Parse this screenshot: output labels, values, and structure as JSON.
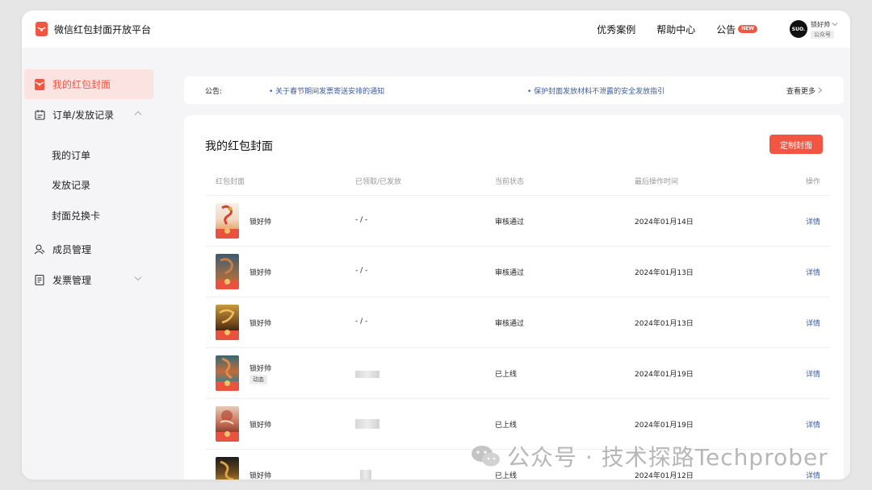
{
  "header": {
    "brand": "微信红包封面开放平台",
    "nav": [
      "优秀案例",
      "帮助中心"
    ],
    "notice_label": "公告",
    "new_badge": "NEW",
    "user": {
      "avatar_text": "SUO.",
      "name": "锁好帅",
      "tag": "公众号"
    }
  },
  "sidebar": {
    "items": [
      {
        "label": "我的红包封面",
        "icon": "red-envelope-icon",
        "active": true
      },
      {
        "label": "订单/发放记录",
        "icon": "calendar-icon",
        "expanded": true
      },
      {
        "label": "成员管理",
        "icon": "member-icon"
      },
      {
        "label": "发票管理",
        "icon": "invoice-icon",
        "expanded": false
      }
    ],
    "sub_items": [
      "我的订单",
      "发放记录",
      "封面兑换卡"
    ]
  },
  "notice_bar": {
    "label": "公告:",
    "items": [
      "关于春节期间发票寄送安排的通知",
      "保护封面发放材料不泄露的安全发放指引"
    ],
    "more": "查看更多"
  },
  "main": {
    "title": "我的红包封面",
    "create_button": "定制封面",
    "columns": [
      "红包封面",
      "已领取/已发放",
      "当前状态",
      "最后操作时间",
      "操作"
    ],
    "rows": [
      {
        "name": "锁好帅",
        "tag": "",
        "count": "- / -",
        "status": "审核通过",
        "time": "2024年01月14日",
        "action": "详情"
      },
      {
        "name": "锁好帅",
        "tag": "",
        "count": "- / -",
        "status": "审核通过",
        "time": "2024年01月13日",
        "action": "详情"
      },
      {
        "name": "锁好帅",
        "tag": "",
        "count": "- / -",
        "status": "审核通过",
        "time": "2024年01月13日",
        "action": "详情"
      },
      {
        "name": "锁好帅",
        "tag": "动态",
        "count": "",
        "status": "已上线",
        "time": "2024年01月19日",
        "action": "详情"
      },
      {
        "name": "锁好帅",
        "tag": "",
        "count": "",
        "status": "已上线",
        "time": "2024年01月19日",
        "action": "详情"
      },
      {
        "name": "锁好帅",
        "tag": "",
        "count": "",
        "status": "已上线",
        "time": "2024年01月12日",
        "action": "详情"
      }
    ]
  },
  "watermark": "公众号 · 技术探路Techprober",
  "colors": {
    "accent": "#f25542",
    "link": "#3a5b9f",
    "active_bg": "#fbe3e1"
  }
}
